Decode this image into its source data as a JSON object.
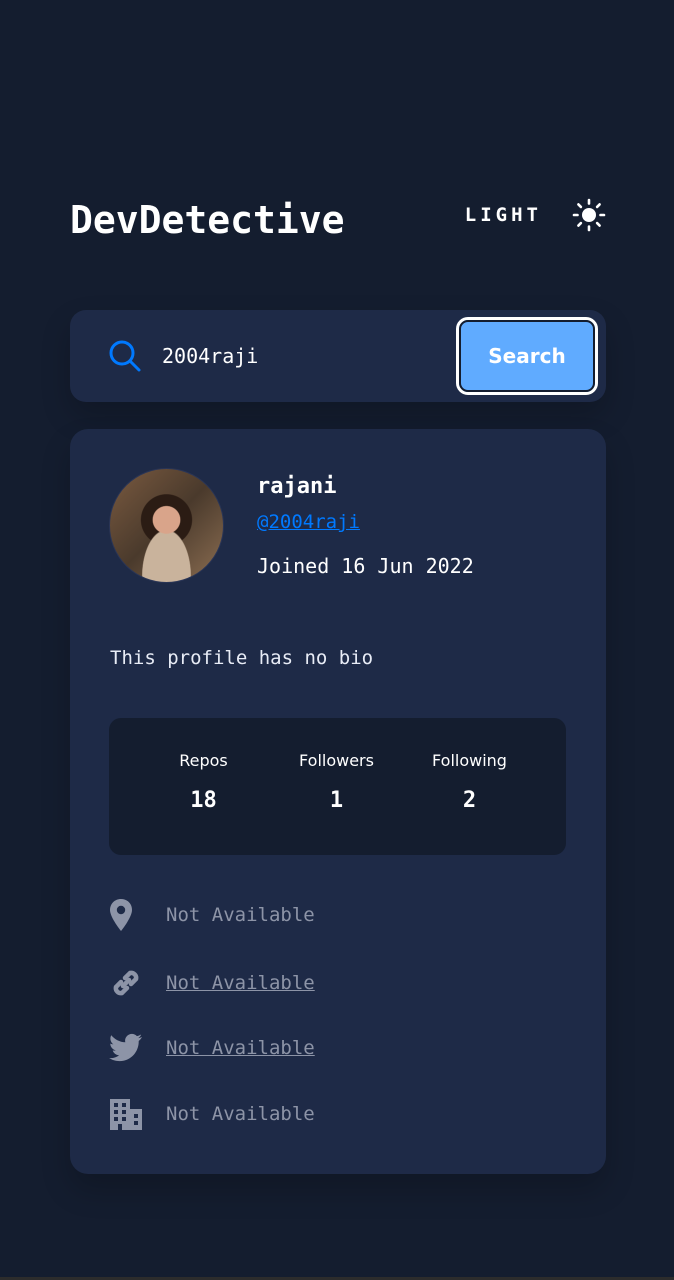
{
  "header": {
    "logo": "DevDetective",
    "theme_label": "LIGHT",
    "theme_icon": "sun-icon"
  },
  "search": {
    "value": "2004raji",
    "placeholder": "Search GitHub username...",
    "button_label": "Search",
    "icon": "search-icon"
  },
  "profile": {
    "name": "rajani",
    "login": "@2004raji",
    "joined": "Joined 16 Jun 2022",
    "bio": "This profile has no bio",
    "avatar": "avatar"
  },
  "stats": {
    "repos": {
      "label": "Repos",
      "value": "18"
    },
    "followers": {
      "label": "Followers",
      "value": "1"
    },
    "following": {
      "label": "Following",
      "value": "2"
    }
  },
  "links": {
    "location": {
      "icon": "location-pin-icon",
      "value": "Not Available"
    },
    "blog": {
      "icon": "link-icon",
      "value": "Not Available"
    },
    "twitter": {
      "icon": "twitter-icon",
      "value": "Not Available"
    },
    "company": {
      "icon": "building-icon",
      "value": "Not Available"
    }
  },
  "colors": {
    "background": "#141d2f",
    "card": "#1e2a47",
    "accent": "#0079ff",
    "button": "#60abff",
    "muted": "#8d94a7"
  }
}
